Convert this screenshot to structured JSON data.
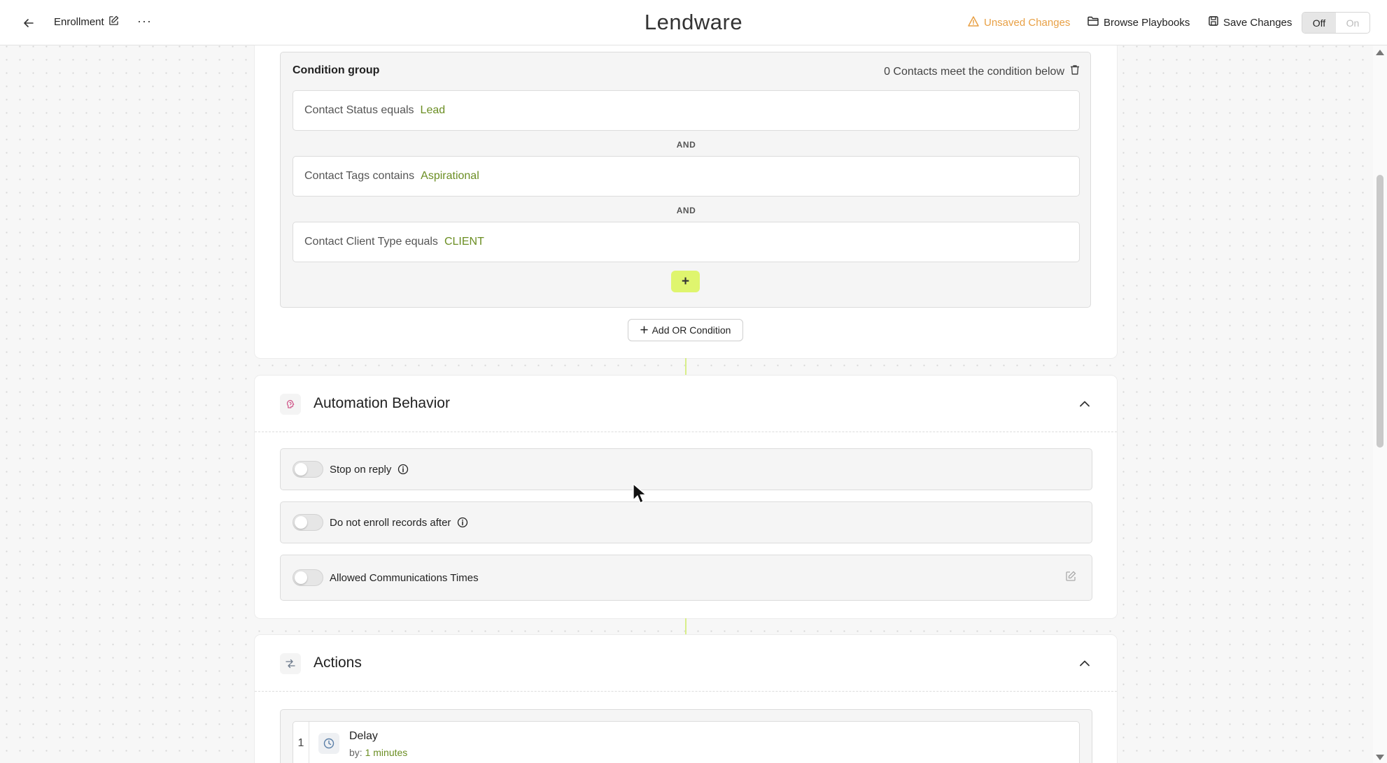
{
  "header": {
    "back_label": "Back",
    "title": "Enrollment",
    "brand": "Lendware",
    "unsaved": "Unsaved Changes",
    "browse": "Browse Playbooks",
    "save": "Save Changes",
    "toggle_off": "Off",
    "toggle_on": "On",
    "toggle_selected": "Off"
  },
  "condition_group": {
    "title": "Condition group",
    "meet_text": "0 Contacts meet the condition below",
    "conditions": [
      {
        "label": "Contact Status equals",
        "value": "Lead"
      },
      {
        "label": "Contact Tags contains",
        "value": "Aspirational"
      },
      {
        "label": "Contact Client Type equals",
        "value": "CLIENT"
      }
    ],
    "and_label": "AND",
    "add_button": "+",
    "add_or_label": "Add OR Condition"
  },
  "automation_behavior": {
    "title": "Automation Behavior",
    "options": [
      {
        "label": "Stop on reply",
        "enabled": false
      },
      {
        "label": "Do not enroll records after",
        "enabled": false
      },
      {
        "label": "Allowed Communications Times",
        "enabled": false
      }
    ]
  },
  "actions": {
    "title": "Actions",
    "items": [
      {
        "index": "1",
        "name": "Delay",
        "by_label": "by:",
        "by_value": "1 minutes"
      }
    ]
  },
  "colors": {
    "accent_green": "#6b8e23",
    "warning_orange": "#e8a045",
    "lime_button": "#dff56e"
  }
}
